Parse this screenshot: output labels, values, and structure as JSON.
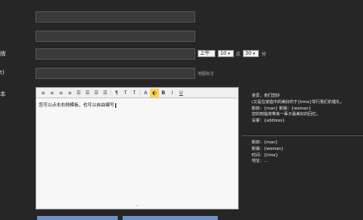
{
  "form": {
    "labels": [
      "牌",
      "t)",
      "本"
    ],
    "toolbar": [
      "≡",
      "≡",
      "≡",
      "≡",
      "☰",
      "☰",
      "☰",
      "☰",
      "¶",
      "T",
      "T",
      "A",
      "◐",
      "B",
      "I",
      "U"
    ],
    "editor_text": "您可以点击右侧模板，也可以自由编写",
    "editor_resize": "⌄"
  },
  "time": {
    "ampm": "上午",
    "hour": "10",
    "hour_unit": "点",
    "minute": "30",
    "minute_unit": "分"
  },
  "hints": {
    "map_label": "地图标注"
  },
  "sidebar": {
    "block1": [
      "亲爱，亲们您好",
      "(又是在家庭中的美好的于{time}举行我们的婚礼，",
      "新郎：{man}   新娘：{woman}",
      "您的到临将带来一辈子最美好的回忆。",
      "设宴：{address}"
    ],
    "block2": [
      "新郎：{man}",
      "新娘：{woman}",
      "时间：{time}",
      "地址：…"
    ]
  },
  "colors": {
    "page_bg": "#262626",
    "field_bg": "#3a3a3a",
    "highlight": "#ffd24c",
    "button": "#6f8fc7"
  },
  "icons": {
    "align": "align-icon",
    "list": "list-icon",
    "font-color": "font-color-icon",
    "highlight": "highlight-icon",
    "bold": "bold-icon",
    "italic": "italic-icon",
    "underline": "underline-icon"
  }
}
